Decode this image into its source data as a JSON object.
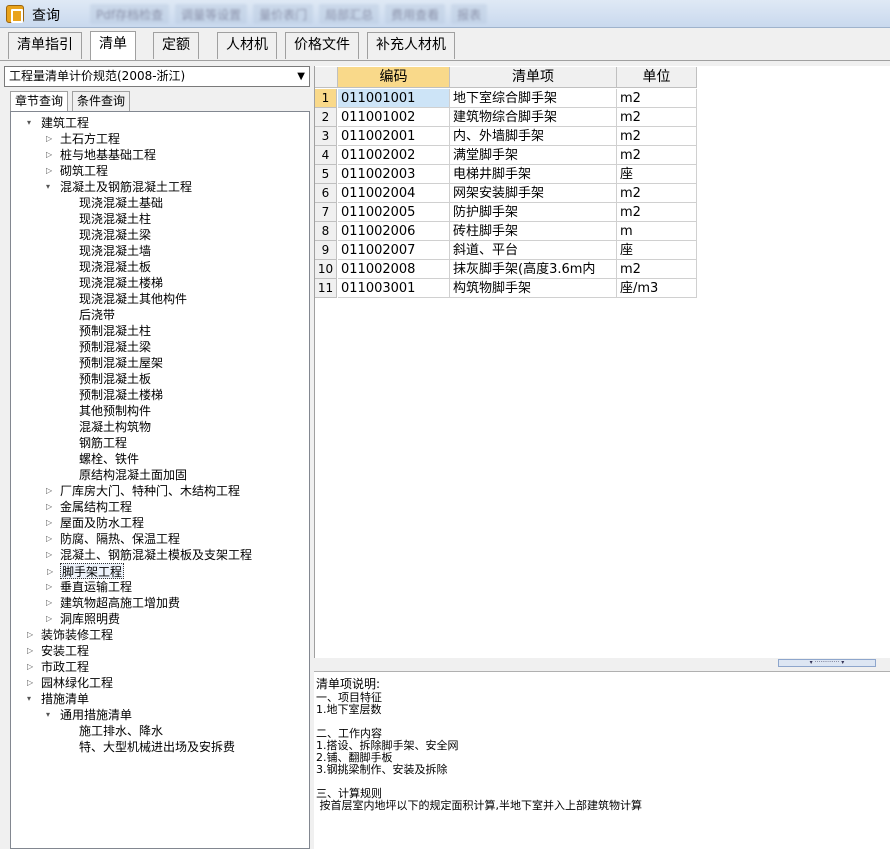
{
  "window": {
    "title": "查询"
  },
  "toolbar_blurred": [
    "Pdf存档检查",
    "调量等设置",
    "量价表门",
    "局部汇总",
    "费用查看",
    "报表"
  ],
  "tabs": [
    "清单指引",
    "清单",
    "定额",
    "人材机",
    "价格文件",
    "补充人材机"
  ],
  "active_tab": "清单",
  "spec_select": {
    "value": "工程量清单计价规范(2008-浙江)"
  },
  "subtabs": [
    "章节查询",
    "条件查询"
  ],
  "tree": [
    {
      "label": "建筑工程",
      "level": 0,
      "toggle": "▾"
    },
    {
      "label": "土石方工程",
      "level": 1,
      "toggle": "▷"
    },
    {
      "label": "桩与地基基础工程",
      "level": 1,
      "toggle": "▷"
    },
    {
      "label": "砌筑工程",
      "level": 1,
      "toggle": "▷"
    },
    {
      "label": "混凝土及钢筋混凝土工程",
      "level": 1,
      "toggle": "▾"
    },
    {
      "label": "现浇混凝土基础",
      "level": 2,
      "toggle": ""
    },
    {
      "label": "现浇混凝土柱",
      "level": 2,
      "toggle": ""
    },
    {
      "label": "现浇混凝土梁",
      "level": 2,
      "toggle": ""
    },
    {
      "label": "现浇混凝土墙",
      "level": 2,
      "toggle": ""
    },
    {
      "label": "现浇混凝土板",
      "level": 2,
      "toggle": ""
    },
    {
      "label": "现浇混凝土楼梯",
      "level": 2,
      "toggle": ""
    },
    {
      "label": "现浇混凝土其他构件",
      "level": 2,
      "toggle": ""
    },
    {
      "label": "后浇带",
      "level": 2,
      "toggle": ""
    },
    {
      "label": "预制混凝土柱",
      "level": 2,
      "toggle": ""
    },
    {
      "label": "预制混凝土梁",
      "level": 2,
      "toggle": ""
    },
    {
      "label": "预制混凝土屋架",
      "level": 2,
      "toggle": ""
    },
    {
      "label": "预制混凝土板",
      "level": 2,
      "toggle": ""
    },
    {
      "label": "预制混凝土楼梯",
      "level": 2,
      "toggle": ""
    },
    {
      "label": "其他预制构件",
      "level": 2,
      "toggle": ""
    },
    {
      "label": "混凝土构筑物",
      "level": 2,
      "toggle": ""
    },
    {
      "label": "钢筋工程",
      "level": 2,
      "toggle": ""
    },
    {
      "label": "螺栓、铁件",
      "level": 2,
      "toggle": ""
    },
    {
      "label": "原结构混凝土面加固",
      "level": 2,
      "toggle": ""
    },
    {
      "label": "厂库房大门、特种门、木结构工程",
      "level": 1,
      "toggle": "▷"
    },
    {
      "label": "金属结构工程",
      "level": 1,
      "toggle": "▷"
    },
    {
      "label": "屋面及防水工程",
      "level": 1,
      "toggle": "▷"
    },
    {
      "label": "防腐、隔热、保温工程",
      "level": 1,
      "toggle": "▷"
    },
    {
      "label": "混凝土、钢筋混凝土模板及支架工程",
      "level": 1,
      "toggle": "▷"
    },
    {
      "label": "脚手架工程",
      "level": 1,
      "toggle": "▷",
      "selected": true
    },
    {
      "label": "垂直运输工程",
      "level": 1,
      "toggle": "▷"
    },
    {
      "label": "建筑物超高施工增加费",
      "level": 1,
      "toggle": "▷"
    },
    {
      "label": "洞库照明费",
      "level": 1,
      "toggle": "▷"
    },
    {
      "label": "装饰装修工程",
      "level": 0,
      "toggle": "▷"
    },
    {
      "label": "安装工程",
      "level": 0,
      "toggle": "▷"
    },
    {
      "label": "市政工程",
      "level": 0,
      "toggle": "▷"
    },
    {
      "label": "园林绿化工程",
      "level": 0,
      "toggle": "▷"
    },
    {
      "label": "措施清单",
      "level": 0,
      "toggle": "▾"
    },
    {
      "label": "通用措施清单",
      "level": 1,
      "toggle": "▾"
    },
    {
      "label": "施工排水、降水",
      "level": 2,
      "toggle": ""
    },
    {
      "label": "特、大型机械进出场及安拆费",
      "level": 2,
      "toggle": ""
    }
  ],
  "grid": {
    "headers": [
      "编码",
      "清单项",
      "单位"
    ],
    "rows": [
      [
        "1",
        "011001001",
        "地下室综合脚手架",
        "m2"
      ],
      [
        "2",
        "011001002",
        "建筑物综合脚手架",
        "m2"
      ],
      [
        "3",
        "011002001",
        "内、外墙脚手架",
        "m2"
      ],
      [
        "4",
        "011002002",
        "满堂脚手架",
        "m2"
      ],
      [
        "5",
        "011002003",
        "电梯井脚手架",
        "座"
      ],
      [
        "6",
        "011002004",
        "网架安装脚手架",
        "m2"
      ],
      [
        "7",
        "011002005",
        "防护脚手架",
        "m2"
      ],
      [
        "8",
        "011002006",
        "砖柱脚手架",
        "m"
      ],
      [
        "9",
        "011002007",
        "斜道、平台",
        "座"
      ],
      [
        "10",
        "011002008",
        "抹灰脚手架(高度3.6m内",
        "m2"
      ],
      [
        "11",
        "011003001",
        "构筑物脚手架",
        "座/m3"
      ]
    ]
  },
  "description": {
    "label": "清单项说明:",
    "text": "一、项目特征\n1.地下室层数\n\n二、工作内容\n1.搭设、拆除脚手架、安全网\n2.铺、翻脚手板\n3.钢挑梁制作、安装及拆除\n\n三、计算规则\n 按首层室内地坪以下的规定面积计算,半地下室并入上部建筑物计算"
  }
}
